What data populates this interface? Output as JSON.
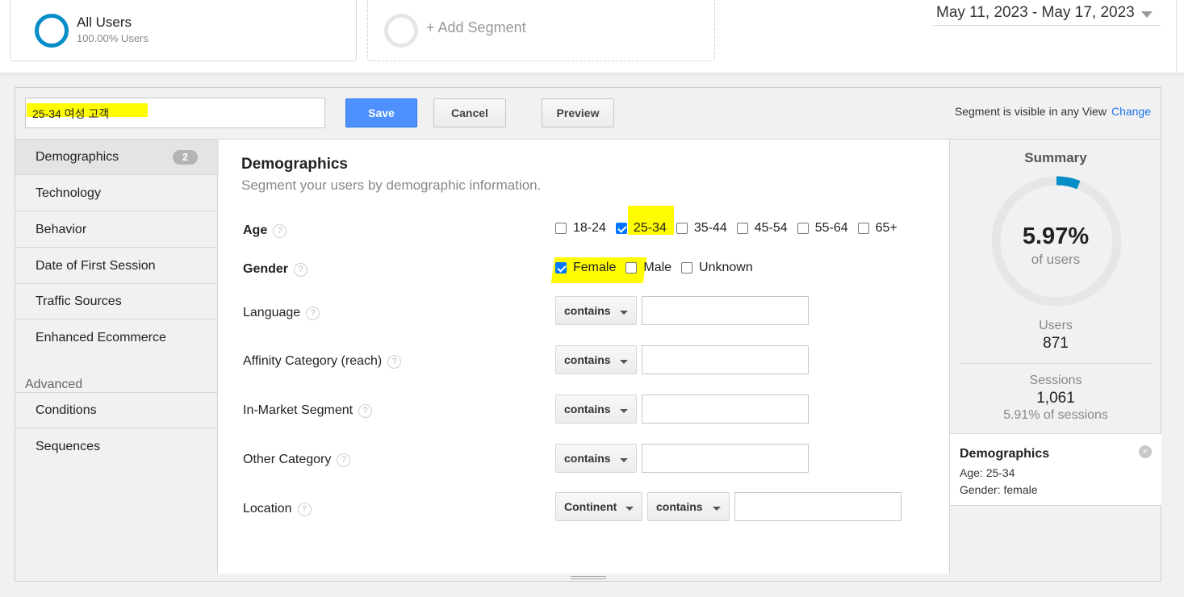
{
  "segments": {
    "all_users": {
      "title": "All Users",
      "subtitle": "100.00% Users"
    },
    "add_segment": {
      "label": "+ Add Segment"
    }
  },
  "date_range": "May 11, 2023 - May 17, 2023",
  "editor": {
    "segment_name": "25-34 여성 고객",
    "save_label": "Save",
    "cancel_label": "Cancel",
    "preview_label": "Preview",
    "visibility_text": "Segment is visible in any View",
    "change_link": "Change"
  },
  "nav": {
    "items": [
      {
        "label": "Demographics",
        "badge": "2",
        "active": true
      },
      {
        "label": "Technology"
      },
      {
        "label": "Behavior"
      },
      {
        "label": "Date of First Session"
      },
      {
        "label": "Traffic Sources"
      },
      {
        "label": "Enhanced Ecommerce"
      }
    ],
    "advanced_heading": "Advanced",
    "advanced_items": [
      {
        "label": "Conditions"
      },
      {
        "label": "Sequences"
      }
    ]
  },
  "demographics": {
    "title": "Demographics",
    "subtitle": "Segment your users by demographic information.",
    "help_glyph": "?",
    "age": {
      "label": "Age",
      "options": [
        {
          "label": "18-24",
          "checked": false
        },
        {
          "label": "25-34",
          "checked": true
        },
        {
          "label": "35-44",
          "checked": false
        },
        {
          "label": "45-54",
          "checked": false
        },
        {
          "label": "55-64",
          "checked": false
        },
        {
          "label": "65+",
          "checked": false
        }
      ]
    },
    "gender": {
      "label": "Gender",
      "options": [
        {
          "label": "Female",
          "checked": true
        },
        {
          "label": "Male",
          "checked": false
        },
        {
          "label": "Unknown",
          "checked": false
        }
      ]
    },
    "fields": [
      {
        "label": "Language",
        "operator": "contains",
        "value": ""
      },
      {
        "label": "Affinity Category (reach)",
        "operator": "contains",
        "value": ""
      },
      {
        "label": "In-Market Segment",
        "operator": "contains",
        "value": ""
      },
      {
        "label": "Other Category",
        "operator": "contains",
        "value": ""
      }
    ],
    "location": {
      "label": "Location",
      "scope": "Continent",
      "operator": "contains",
      "value": ""
    }
  },
  "summary": {
    "title": "Summary",
    "percent": "5.97%",
    "percent_value": 0.0597,
    "of_label": "of users",
    "users_label": "Users",
    "users_value": "871",
    "sessions_label": "Sessions",
    "sessions_value": "1,061",
    "sessions_pct": "5.91% of sessions",
    "box": {
      "title": "Demographics",
      "age_line": "Age: 25-34",
      "gender_line": "Gender: female",
      "close_glyph": "×"
    }
  },
  "colors": {
    "accent_blue": "#058dc7",
    "save_blue": "#4d90fe",
    "highlight": "#fffb00"
  }
}
